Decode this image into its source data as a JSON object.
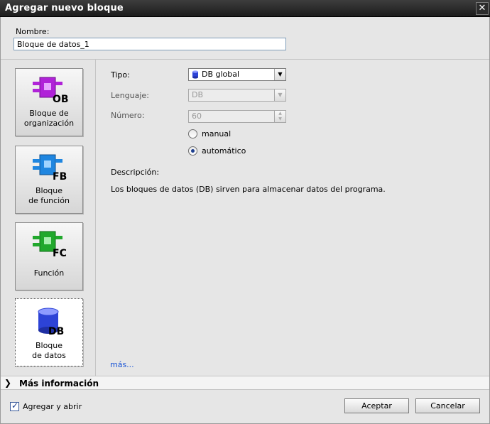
{
  "dialog": {
    "title": "Agregar nuevo bloque",
    "close_glyph": "✕"
  },
  "name": {
    "label": "Nombre:",
    "value": "Bloque de datos_1"
  },
  "block_types": [
    {
      "badge": "OB",
      "label_line1": "Bloque de",
      "label_line2": "organización",
      "color": "#b023d8"
    },
    {
      "badge": "FB",
      "label_line1": "Bloque",
      "label_line2": "de función",
      "color": "#1f86e0"
    },
    {
      "badge": "FC",
      "label_line1": "Función",
      "label_line2": "",
      "color": "#21a82c"
    },
    {
      "badge": "DB",
      "label_line1": "Bloque",
      "label_line2": "de datos",
      "color": "#2d43d6"
    }
  ],
  "form": {
    "type_label": "Tipo:",
    "type_value": "DB global",
    "language_label": "Lenguaje:",
    "language_value": "DB",
    "number_label": "Número:",
    "number_value": "60",
    "radio_manual": "manual",
    "radio_auto": "automático",
    "selected_radio": "automático"
  },
  "description": {
    "title": "Descripción:",
    "text": "Los bloques de datos (DB) sirven para almacenar datos del programa."
  },
  "more_link": "más...",
  "more_info": "Más información",
  "footer": {
    "add_and_open": "Agregar y abrir",
    "add_and_open_checked": true,
    "ok": "Aceptar",
    "cancel": "Cancelar"
  },
  "colors": {
    "titlebar": "#2a2a2a",
    "link": "#1a55d6",
    "db_icon": "#2d43d6"
  },
  "icons": [
    "close-icon",
    "ob-block-icon",
    "fb-block-icon",
    "fc-block-icon",
    "db-block-icon",
    "db-small-icon",
    "chevron-right-icon",
    "dropdown-arrow-icon",
    "spin-arrows-icon",
    "checkmark-icon"
  ]
}
